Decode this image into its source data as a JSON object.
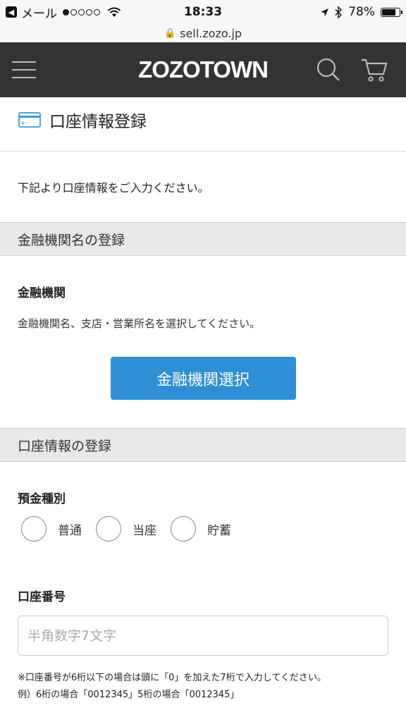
{
  "status_bar": {
    "back_label": "メール",
    "time": "18:33",
    "battery": "78%",
    "battery_level": 0.78
  },
  "browser": {
    "url": "sell.zozo.jp"
  },
  "header": {
    "logo": "ZOZOTOWN"
  },
  "page": {
    "title": "口座情報登録",
    "intro": "下記より口座情報をご入力ください。"
  },
  "bank_section": {
    "header": "金融機関名の登録",
    "label": "金融機関",
    "help": "金融機関名、支店・営業所名を選択してください。",
    "button": "金融機関選択"
  },
  "account_section": {
    "header": "口座情報の登録",
    "type_label": "預金種別",
    "types": [
      "普通",
      "当座",
      "貯蓄"
    ],
    "number_label": "口座番号",
    "number_value": "",
    "number_placeholder": "半角数字7文字",
    "note_1": "※口座番号が6桁以下の場合は頭に「0」を加えた7桁で入力してください。",
    "note_2": "例）6桁の場合「0012345」5桁の場合「0012345」"
  },
  "colors": {
    "header_bg": "#333333",
    "button_blue": "#2e8fd6",
    "icon_blue": "#3a9ad9"
  },
  "icons": [
    "arrow-back-icon",
    "wifi-icon",
    "location-arrow-icon",
    "bluetooth-icon",
    "battery-icon",
    "lock-icon",
    "hamburger-icon",
    "search-icon",
    "cart-icon",
    "bank-card-icon"
  ]
}
